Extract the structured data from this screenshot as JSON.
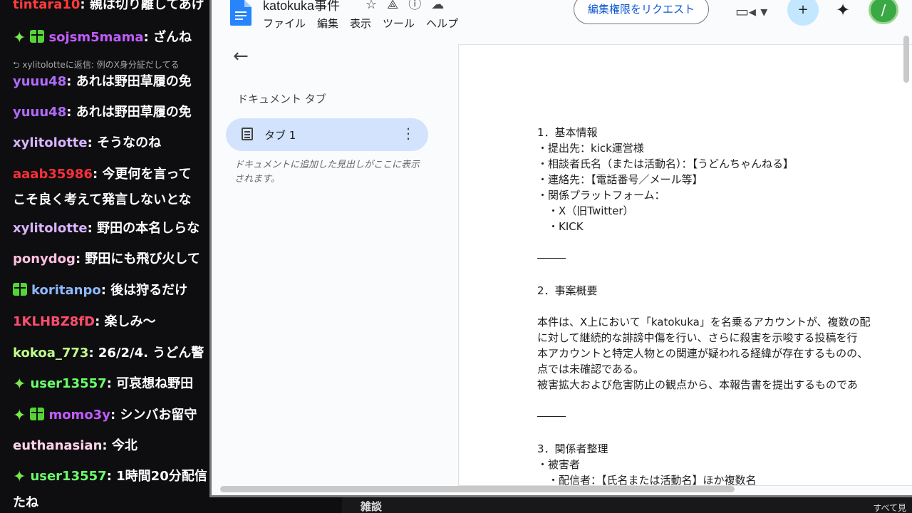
{
  "chat": {
    "messages": [
      {
        "user": "tintara10",
        "color": "#ff3b3b",
        "text": ": 親は切り離してあげ"
      },
      {
        "user": "sojsm5mama",
        "color": "#c15cff",
        "text": ": ざんね"
      },
      {
        "user": "yuuu48",
        "color": "#b36bff",
        "text": ": あれは野田草履の免"
      },
      {
        "user": "yuuu48",
        "color": "#b36bff",
        "text": ": あれは野田草履の免"
      },
      {
        "user": "xylitolotte",
        "color": "#d9b3ff",
        "text": ": そうなのね"
      },
      {
        "user": "aaab35986",
        "color": "#ff2e3a",
        "text": ": 今更何を言って"
      },
      {
        "user": "xylitolotte",
        "color": "#d9b3ff",
        "text": ": 野田の本名しらな"
      },
      {
        "user": "ponydog",
        "color": "#ffc0e0",
        "text": ": 野田にも飛び火して"
      },
      {
        "user": "koritanpo",
        "color": "#8fb8ff",
        "text": ": 後は狩るだけ"
      },
      {
        "user": "1KLHBZ8fD",
        "color": "#ff4d6d",
        "text": ": 楽しみ〜"
      },
      {
        "user": "kokoa_773",
        "color": "#bfff8a",
        "text": ": 26/2/4. うどん警"
      },
      {
        "user": "user13557",
        "color": "#6bff6b",
        "text": ": 可哀想ね野田"
      },
      {
        "user": "momo3y",
        "color": "#c15cff",
        "text": ": シンバお留守"
      },
      {
        "user": "euthanasian",
        "color": "#ffd2ec",
        "text": ": 今北"
      },
      {
        "user": "user13557",
        "color": "#6bff6b",
        "text": ": 1時間20分配信"
      }
    ],
    "reply_text": "⮌ xylitolotteに返信: 例のX身分証だしてる",
    "continuation_1": "こそ良く考えて発言しないとな",
    "continuation_2": "たね"
  },
  "docs": {
    "title": "katokuka事件",
    "menu": [
      "ファイル",
      "編集",
      "表示",
      "ツール",
      "ヘルプ"
    ],
    "request_button": "編集権限をリクエスト",
    "avatar_letter": "/",
    "sidebar": {
      "heading": "ドキュメント タブ",
      "tab_label": "タブ 1",
      "note": "ドキュメントに追加した見出しがここに表示されます。"
    },
    "content": [
      "1．基本情報",
      "・提出先：kick運営様",
      "・相談者氏名（または活動名）：【うどんちゃんねる】",
      "・連絡先：【電話番号／メール等】",
      "・関係プラットフォーム：",
      "　・X（旧Twitter）",
      "　・KICK",
      "2．事案概要",
      "本件は、X上において「katokuka」を名乗るアカウントが、複数の配",
      "に対して継続的な誹謗中傷を行い、さらに殺害を示唆する投稿を行",
      "本アカウントと特定人物との関連が疑われる経緯が存在するものの、",
      "点では未確認である。",
      "被害拡大および危害防止の観点から、本報告書を提出するものであ",
      "3．関係者整理",
      "・被害者",
      "　・配信者：【氏名または活動名】ほか複数名"
    ]
  },
  "bottom": {
    "left_label": "雑談",
    "right_label": "すべて見"
  }
}
